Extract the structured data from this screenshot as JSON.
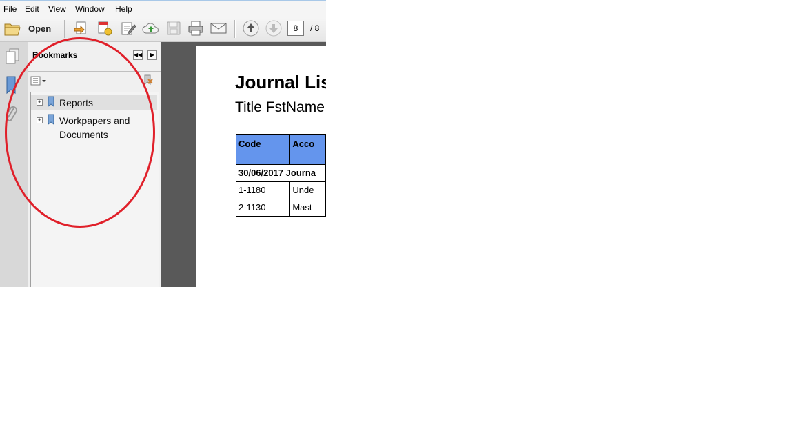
{
  "menubar": {
    "items": [
      "File",
      "Edit",
      "View",
      "Window",
      "Help"
    ]
  },
  "toolbar": {
    "open_label": "Open",
    "page_current": "8",
    "page_total": "/ 8"
  },
  "nav_panel": {
    "title": "Bookmarks",
    "bookmarks": [
      {
        "label": "Reports"
      },
      {
        "label": "Workpapers and\nDocuments"
      }
    ]
  },
  "document": {
    "title": "Journal Lis",
    "subtitle": "Title FstName",
    "table": {
      "headers": [
        "Code",
        "Acco"
      ],
      "group_row": "30/06/2017 Journa",
      "rows": [
        [
          "1-1180",
          "Unde"
        ],
        [
          "2-1130",
          "Mast"
        ]
      ]
    }
  },
  "colors": {
    "highlight_circle": "#e0202a",
    "table_header": "#6495ed",
    "viewer_background": "#595959"
  }
}
